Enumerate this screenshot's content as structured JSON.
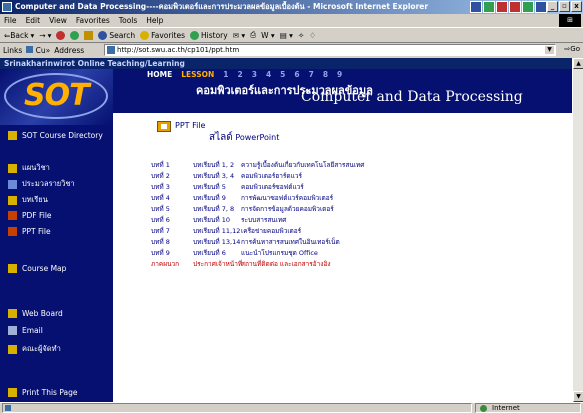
{
  "window": {
    "title": "Computer and Data Processing----คอมพิวเตอร์และการประมวลผลข้อมูลเบื้องต้น - Microsoft Internet Explorer",
    "controls": [
      "_",
      "▫",
      "x"
    ]
  },
  "menu": [
    "File",
    "Edit",
    "View",
    "Favorites",
    "Tools",
    "Help"
  ],
  "toolbar": {
    "back": "⇐Back",
    "forward": "→",
    "search": "Search",
    "favorites": "Favorites",
    "history": "History"
  },
  "address": {
    "links_label": "Links",
    "cu_label": "Cu",
    "chevron": "»",
    "label": "Address",
    "url": "http://sot.swu.ac.th/cp101/ppt.htm",
    "go": "Go"
  },
  "site": {
    "header": "Srinakharinwirot Online Teaching/Learning",
    "logo": "SOT",
    "nav": [
      {
        "label": "SOT Course Directory",
        "color": "#d8b000"
      },
      {
        "label": "แผนวิชา",
        "color": "#d8b000"
      },
      {
        "label": "ประมวลรายวิชา",
        "color": "#6a8ad8"
      },
      {
        "label": "บทเรียน",
        "color": "#d8b000"
      },
      {
        "label": "PDF File",
        "color": "#c84000"
      },
      {
        "label": "PPT File",
        "color": "#c84000"
      },
      {
        "label": "Course Map",
        "color": "#d8b000"
      },
      {
        "label": "Web Board",
        "color": "#d8b000"
      },
      {
        "label": "Email",
        "color": "#a0b0d8"
      },
      {
        "label": "คณะผู้จัดทำ",
        "color": "#d8b000"
      },
      {
        "label": "Print This Page",
        "color": "#d8b000"
      }
    ],
    "lesson_nav": {
      "home": "HOME",
      "lesson": "LESSON",
      "numbers": [
        "1",
        "2",
        "3",
        "4",
        "5",
        "6",
        "7",
        "8",
        "9"
      ]
    },
    "title_th": "คอมพิวเตอร์และการประมวลผลข้อมูล",
    "title_en": "Computer and Data Processing",
    "ppt_label": "PPT File",
    "ppt_sub_th": "สไลด์",
    "ppt_sub_en": "PowerPoint",
    "chapters": [
      {
        "ch": "บทที่ 1",
        "lessons": "บทเรียนที่ 1, 2",
        "title": "ความรู้เบื้องต้นเกี่ยวกับเทคโนโลยีสารสนเทศ"
      },
      {
        "ch": "บทที่ 2",
        "lessons": "บทเรียนที่ 3, 4",
        "title": "คอมพิวเตอร์ฮาร์ดแวร์"
      },
      {
        "ch": "บทที่ 3",
        "lessons": "บทเรียนที่ 5",
        "title": "คอมพิวเตอร์ซอฟต์แวร์"
      },
      {
        "ch": "บทที่ 4",
        "lessons": "บทเรียนที่ 9",
        "title": "การพัฒนาซอฟต์แวร์คอมพิวเตอร์"
      },
      {
        "ch": "บทที่ 5",
        "lessons": "บทเรียนที่ 7, 8",
        "title": "การจัดการข้อมูลด้วยคอมพิวเตอร์"
      },
      {
        "ch": "บทที่ 6",
        "lessons": "บทเรียนที่ 10",
        "title": "ระบบสารสนเทศ"
      },
      {
        "ch": "บทที่ 7",
        "lessons": "บทเรียนที่ 11,12",
        "title": "เครือข่ายคอมพิวเตอร์"
      },
      {
        "ch": "บทที่ 8",
        "lessons": "บทเรียนที่ 13,14",
        "title": "การค้นหาสารสนเทศในอินเทอร์เน็ต"
      },
      {
        "ch": "บทที่ 9",
        "lessons": "บทเรียนที่ 6",
        "title": "แนะนำโปรแกรมชุด Office"
      },
      {
        "ch": "ภาคผนวก",
        "lessons": "ประกาศเจ้าหน้าที่",
        "title": "สถานที่ติดต่อ และเอกสารอ้างอิง",
        "red": true
      }
    ]
  },
  "status": {
    "left": "",
    "zone": "Internet"
  }
}
